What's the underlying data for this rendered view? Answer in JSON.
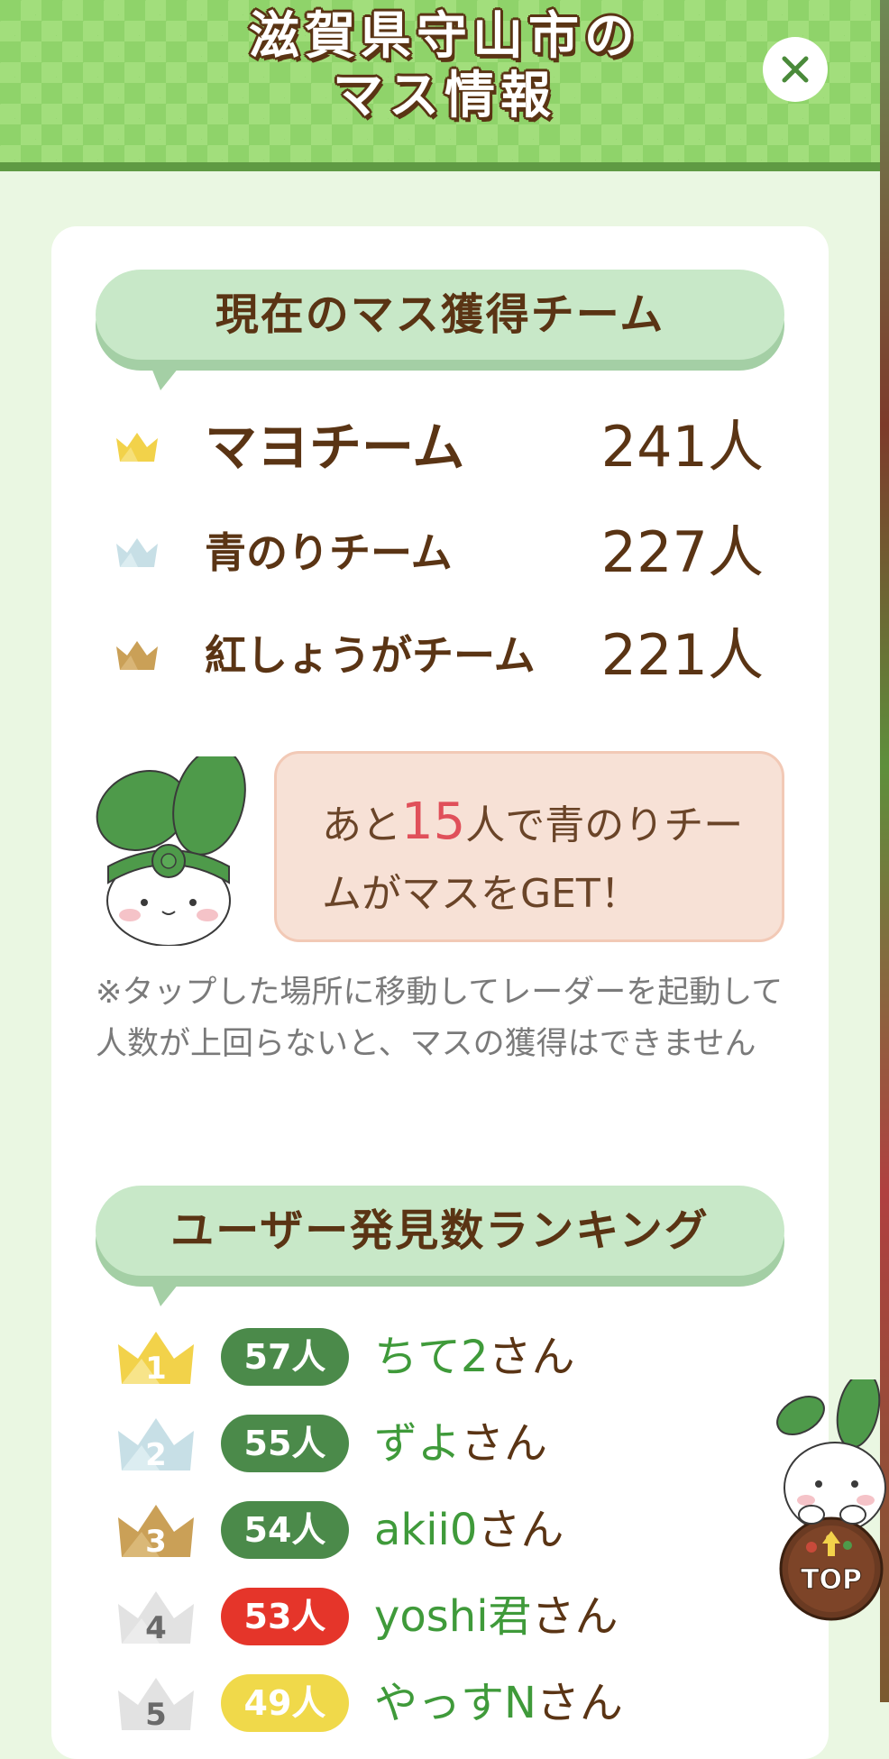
{
  "header": {
    "title_line1": "滋賀県守山市の",
    "title_line2": "マス情報"
  },
  "teams_section": {
    "heading": "現在のマス獲得チーム",
    "teams": [
      {
        "name": "マヨチーム",
        "count": "241人",
        "crown": "gold-crown-icon"
      },
      {
        "name": "青のりチーム",
        "count": "227人",
        "crown": "silver-crown-icon"
      },
      {
        "name": "紅しょうがチーム",
        "count": "221人",
        "crown": "bronze-crown-icon"
      }
    ],
    "notice": {
      "pre": "あと",
      "number": "15",
      "post": "人で青のりチームがマスをGET！"
    },
    "note": "※タップした場所に移動してレーダーを起動して人数が上回らないと、マスの獲得はできません"
  },
  "ranking_section": {
    "heading": "ユーザー発見数ランキング",
    "rows": [
      {
        "rank": "1",
        "count": "57人",
        "nick": "ちて2",
        "suffix": "さん"
      },
      {
        "rank": "2",
        "count": "55人",
        "nick": "ずよ",
        "suffix": "さん"
      },
      {
        "rank": "3",
        "count": "54人",
        "nick": "akii0",
        "suffix": "さん"
      },
      {
        "rank": "4",
        "count": "53人",
        "nick": "yoshi君",
        "suffix": "さん"
      },
      {
        "rank": "5",
        "count": "49人",
        "nick": "やっすN",
        "suffix": "さん"
      }
    ]
  },
  "top_button": {
    "label": "TOP"
  },
  "colors": {
    "header_green": "#8fd36a",
    "heading_green": "#c8e8c8",
    "pill_green": "#4b8a4a",
    "pill_red": "#e5352a",
    "pill_yellow": "#f0d94a",
    "gold": "#f2d24a",
    "silver": "#c7dfe6",
    "bronze": "#caa057",
    "gray_crown": "#e2e2e2"
  }
}
